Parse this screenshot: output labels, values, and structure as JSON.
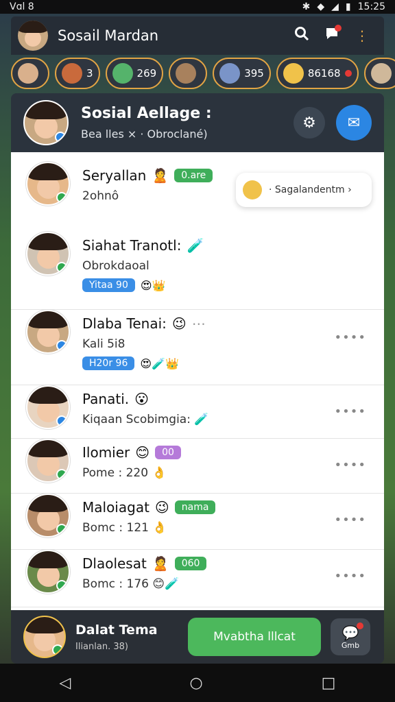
{
  "status_bar": {
    "left_text": "Vɑl 8",
    "time": "15:25"
  },
  "app_bar": {
    "title": "Sosail Mardan"
  },
  "stories": [
    {
      "label": ""
    },
    {
      "label": "3"
    },
    {
      "label": "269"
    },
    {
      "label": ""
    },
    {
      "label": "395"
    },
    {
      "label": "86168"
    },
    {
      "label": ""
    }
  ],
  "header": {
    "title": "Sosial Aellage :",
    "subtitle": "Bea lles × · Obroclané)"
  },
  "chip": {
    "label": "· Sagalandentm ›"
  },
  "contacts": [
    {
      "name": "Seryallan",
      "sub": "2ohnô",
      "tag": "0.are",
      "tag_color": "green",
      "status": "green"
    },
    {
      "name": "Siahat Tranotl: ",
      "sub": "Obrokdaoal",
      "tag": "Yitaa 90",
      "tag_color": "blue",
      "status": "green"
    },
    {
      "name": "Dlaba Tenai:",
      "sub": "Kali 5i8",
      "tag": "H20r 96",
      "tag_color": "blue",
      "status": "blue"
    },
    {
      "name": "Panati.",
      "sub": "Kiqaan Scobimgia:",
      "tag": "",
      "tag_color": "",
      "status": "blue"
    },
    {
      "name": "Ilomier",
      "sub": "Pome : 220",
      "tag": "00",
      "tag_color": "purple",
      "status": "green"
    },
    {
      "name": "Maloiagat",
      "sub": "Bomc : 121",
      "tag": "nama",
      "tag_color": "green",
      "status": "green"
    },
    {
      "name": "Dlaolesat",
      "sub": "Bomc : 176",
      "tag": "060",
      "tag_color": "green",
      "status": "green"
    }
  ],
  "bottom_bar": {
    "name": "Dalat Tema",
    "sub": "Ilianlan. 38)",
    "cta_label": "Mvabtha lllcat",
    "fab_label": "Gmb"
  },
  "colors": {
    "accent_blue": "#2b86e3",
    "accent_green": "#4cb85c",
    "header_bg": "#2b333d"
  }
}
